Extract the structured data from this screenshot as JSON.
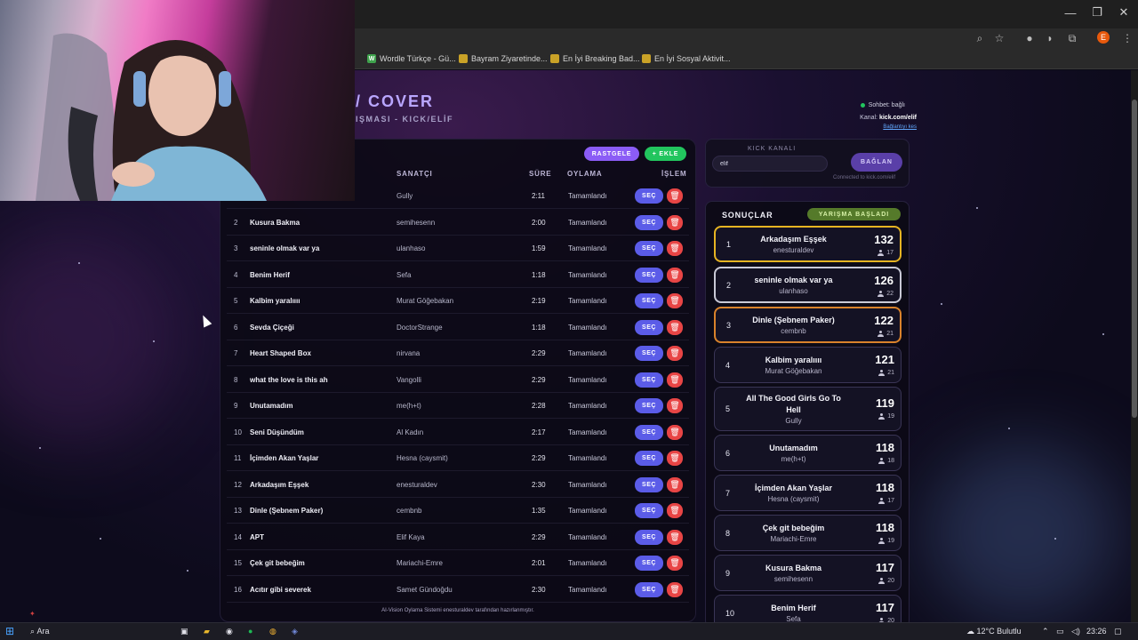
{
  "browser": {
    "bookmarks": [
      {
        "label": "Wordle Türkçe - Gü...",
        "icon": "W"
      },
      {
        "label": "Bayram Ziyaretinde..."
      },
      {
        "label": "En İyi Breaking Bad..."
      },
      {
        "label": "En İyi Sosyal Aktivit..."
      }
    ],
    "profile_letter": "E"
  },
  "app": {
    "title": "/ COVER",
    "subtitle": "IŞMASI - KICK/ELİF",
    "chat_status": "Sohbet: bağlı",
    "kanal_label": "Kanal:",
    "kanal_value": "kick.com/elif",
    "disconnect": "Bağlantıyı kes"
  },
  "toolbar": {
    "random": "RASTGELE",
    "add": "+ EKLE"
  },
  "table": {
    "headers": {
      "artist": "SANATÇI",
      "duration": "SÜRE",
      "vote": "OYLAMA",
      "action": "İŞLEM"
    },
    "select_label": "SEÇ",
    "rows": [
      {
        "num": "",
        "song": "",
        "artist": "Gully",
        "dur": "2:11",
        "vote": "Tamamlandı"
      },
      {
        "num": "2",
        "song": "Kusura Bakma",
        "artist": "semihesenn",
        "dur": "2:00",
        "vote": "Tamamlandı"
      },
      {
        "num": "3",
        "song": "seninle olmak var ya",
        "artist": "ulanhaso",
        "dur": "1:59",
        "vote": "Tamamlandı"
      },
      {
        "num": "4",
        "song": "Benim Herif",
        "artist": "Sefa",
        "dur": "1:18",
        "vote": "Tamamlandı"
      },
      {
        "num": "5",
        "song": "Kalbim yaralıııı",
        "artist": "Murat Göğebakan",
        "dur": "2:19",
        "vote": "Tamamlandı"
      },
      {
        "num": "6",
        "song": "Sevda Çiçeği",
        "artist": "DoctorStrange",
        "dur": "1:18",
        "vote": "Tamamlandı"
      },
      {
        "num": "7",
        "song": "Heart Shaped Box",
        "artist": "nirvana",
        "dur": "2:29",
        "vote": "Tamamlandı"
      },
      {
        "num": "8",
        "song": "what the love is this ah",
        "artist": "Vangolli",
        "dur": "2:29",
        "vote": "Tamamlandı"
      },
      {
        "num": "9",
        "song": "Unutamadım",
        "artist": "me(h+t)",
        "dur": "2:28",
        "vote": "Tamamlandı"
      },
      {
        "num": "10",
        "song": "Seni Düşündüm",
        "artist": "Al Kadın",
        "dur": "2:17",
        "vote": "Tamamlandı"
      },
      {
        "num": "11",
        "song": "İçimden Akan Yaşlar",
        "artist": "Hesna (caysmit)",
        "dur": "2:29",
        "vote": "Tamamlandı"
      },
      {
        "num": "12",
        "song": "Arkadaşım Eşşek",
        "artist": "enesturaldev",
        "dur": "2:30",
        "vote": "Tamamlandı"
      },
      {
        "num": "13",
        "song": "Dinle (Şebnem Paker)",
        "artist": "cembnb",
        "dur": "1:35",
        "vote": "Tamamlandı"
      },
      {
        "num": "14",
        "song": "APT",
        "artist": "Elif Kaya",
        "dur": "2:29",
        "vote": "Tamamlandı"
      },
      {
        "num": "15",
        "song": "Çek git bebeğim",
        "artist": "Mariachi-Emre",
        "dur": "2:01",
        "vote": "Tamamlandı"
      },
      {
        "num": "16",
        "song": "Acıtır gibi severek",
        "artist": "Samet Gündoğdu",
        "dur": "2:30",
        "vote": "Tamamlandı"
      }
    ],
    "footer": "AI-Vision Oylama Sistemi enesturaldev tarafından hazırlanmıştır."
  },
  "kick": {
    "label": "KICK KANALI",
    "input_value": "elif",
    "connect": "BAĞLAN",
    "connected_text": "Connected to kick.com/elif"
  },
  "results": {
    "title": "SONUÇLAR",
    "badge": "YARIŞMA BAŞLADI",
    "items": [
      {
        "rank": "1",
        "song": "Arkadaşım Eşşek",
        "artist": "enesturaldev",
        "score": "132",
        "voters": "17",
        "border": "#e6b422"
      },
      {
        "rank": "2",
        "song": "seninle olmak var ya",
        "artist": "ulanhaso",
        "score": "126",
        "voters": "22",
        "border": "#c9c9d6"
      },
      {
        "rank": "3",
        "song": "Dinle (Şebnem Paker)",
        "artist": "cembnb",
        "score": "122",
        "voters": "21",
        "border": "#d9822b"
      },
      {
        "rank": "4",
        "song": "Kalbim yaralıııı",
        "artist": "Murat Göğebakan",
        "score": "121",
        "voters": "21",
        "border": "#3a3556"
      },
      {
        "rank": "5",
        "song": "All The Good Girls Go To Hell",
        "artist": "Gully",
        "score": "119",
        "voters": "19",
        "border": "#3a3556"
      },
      {
        "rank": "6",
        "song": "Unutamadım",
        "artist": "me(h+t)",
        "score": "118",
        "voters": "18",
        "border": "#3a3556"
      },
      {
        "rank": "7",
        "song": "İçimden Akan Yaşlar",
        "artist": "Hesna (caysmit)",
        "score": "118",
        "voters": "17",
        "border": "#3a3556"
      },
      {
        "rank": "8",
        "song": "Çek git bebeğim",
        "artist": "Mariachi-Emre",
        "score": "118",
        "voters": "19",
        "border": "#3a3556"
      },
      {
        "rank": "9",
        "song": "Kusura Bakma",
        "artist": "semihesenn",
        "score": "117",
        "voters": "20",
        "border": "#3a3556"
      },
      {
        "rank": "10",
        "song": "Benim Herif",
        "artist": "Sefa",
        "score": "117",
        "voters": "20",
        "border": "#3a3556"
      }
    ]
  },
  "taskbar": {
    "search": "Ara",
    "weather": "12°C  Bulutlu",
    "time": "23:26"
  },
  "colors": {
    "accent": "#5b5ce8",
    "danger": "#e84545",
    "success": "#22c55e",
    "purple_btn": "#8b5cf6"
  }
}
